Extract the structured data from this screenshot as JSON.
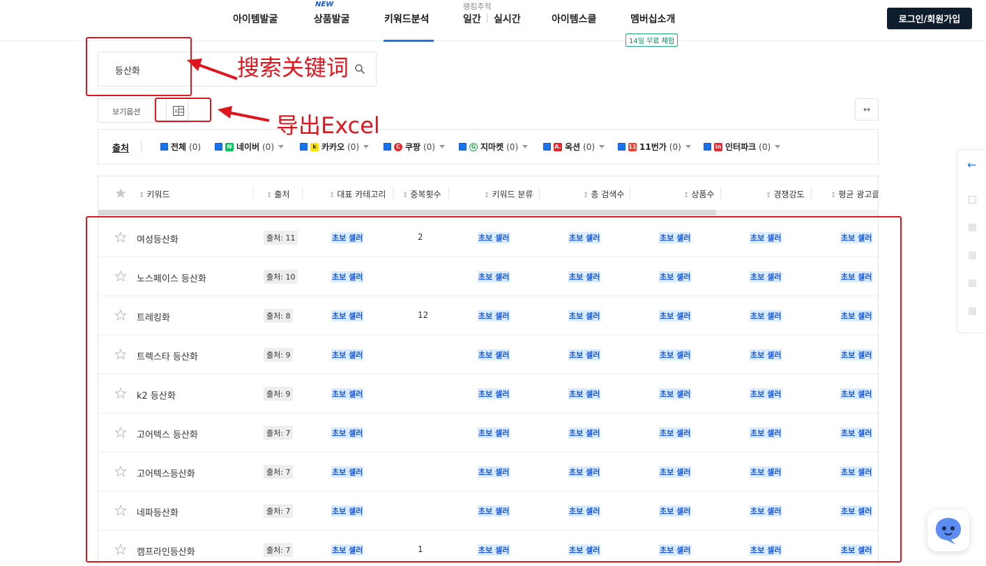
{
  "header": {
    "nav": [
      {
        "label": "아이템발굴"
      },
      {
        "label": "상품발굴",
        "badge": "NEW"
      },
      {
        "label": "키워드분석"
      },
      {
        "label": "일간",
        "group_label": "랭킹추적"
      },
      {
        "label": "실시간"
      },
      {
        "label": "아이템스쿨"
      },
      {
        "label": "멤버십소개",
        "badge": "14일 무료 체험"
      }
    ],
    "login_label": "로그인/회원가입"
  },
  "search": {
    "value": "등산화",
    "icon": "search-icon"
  },
  "view_options": {
    "label": "보기옵션",
    "excel_icon": "excel-icon",
    "expand_icon": "expand-horizontal-icon"
  },
  "filters": {
    "title": "출처",
    "sources": [
      {
        "name": "전체",
        "count": "(0)"
      },
      {
        "name": "네이버",
        "count": "(0)",
        "logo": "N",
        "color": "#03c75a"
      },
      {
        "name": "카카오",
        "count": "(0)",
        "logo": "k",
        "color": "#fee500"
      },
      {
        "name": "쿠팡",
        "count": "(0)",
        "logo": "C",
        "color": "#e8272c"
      },
      {
        "name": "지마켓",
        "count": "(0)",
        "logo": "G",
        "color": "#ffffff"
      },
      {
        "name": "옥션",
        "count": "(0)",
        "logo": "A.",
        "color": "#e8272c"
      },
      {
        "name": "11번가",
        "count": "(0)",
        "logo": "11",
        "color": "#ff3a2f"
      },
      {
        "name": "인터파크",
        "count": "(0)",
        "logo": "in",
        "color": "#e8272c"
      }
    ]
  },
  "table": {
    "columns": [
      "키워드",
      "출처",
      "대표 카테고리",
      "중복횟수",
      "키워드 분류",
      "총 검색수",
      "상품수",
      "경쟁강도",
      "평균 광고클"
    ],
    "locked_label": "초보 셀러",
    "rows": [
      {
        "keyword": "여성등산화",
        "source": "출처: 11",
        "dup": "2"
      },
      {
        "keyword": "노스페이스 등산화",
        "source": "출처: 10",
        "dup": ""
      },
      {
        "keyword": "트레킹화",
        "source": "출처: 8",
        "dup": "12"
      },
      {
        "keyword": "트렉스타 등산화",
        "source": "출처: 9",
        "dup": ""
      },
      {
        "keyword": "k2 등산화",
        "source": "출처: 9",
        "dup": ""
      },
      {
        "keyword": "고어텍스 등산화",
        "source": "출처: 7",
        "dup": ""
      },
      {
        "keyword": "고어텍스등산화",
        "source": "출처: 7",
        "dup": ""
      },
      {
        "keyword": "네파등산화",
        "source": "출처: 7",
        "dup": ""
      },
      {
        "keyword": "캠프라인등산화",
        "source": "출처: 7",
        "dup": "1"
      }
    ]
  },
  "annotations": {
    "search_note": "搜索关键词",
    "export_note": "导出Excel",
    "color": "#e0161e"
  }
}
